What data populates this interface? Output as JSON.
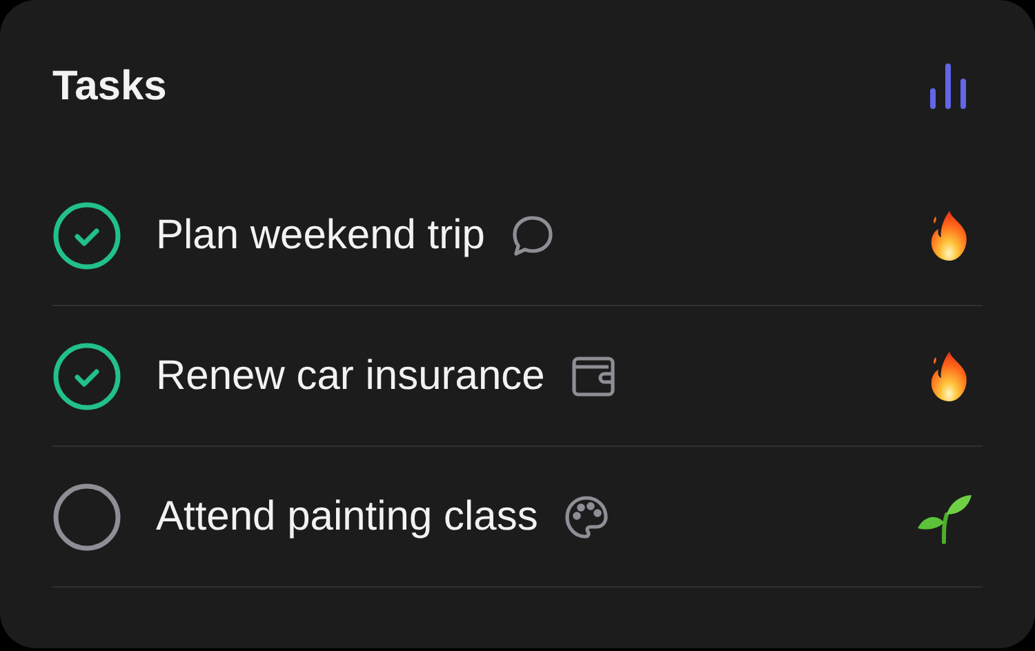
{
  "title": "Tasks",
  "tasks": [
    {
      "label": "Plan weekend trip",
      "checked": true
    },
    {
      "label": "Renew car insurance",
      "checked": true
    },
    {
      "label": "Attend painting class",
      "checked": false
    }
  ]
}
